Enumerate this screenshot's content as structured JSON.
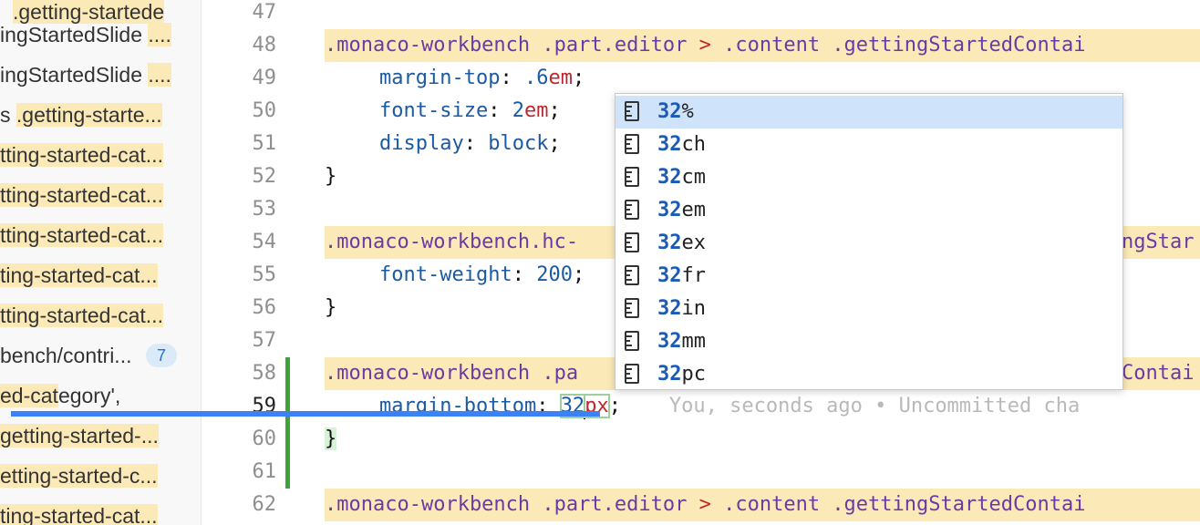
{
  "sidebar": {
    "results": [
      {
        "prefix": "",
        "match": ".getting-startede",
        "ellipsis": ""
      },
      {
        "prefix": "ingStartedSlide ",
        "match": "....",
        "ellipsis": ""
      },
      {
        "prefix": "ingStartedSlide ",
        "match": "....",
        "ellipsis": ""
      },
      {
        "prefix": "s ",
        "match": ".getting-starte...",
        "ellipsis": ""
      },
      {
        "prefix": "",
        "match": "tting-started-cat...",
        "ellipsis": ""
      },
      {
        "prefix": "",
        "match": "tting-started-cat...",
        "ellipsis": ""
      },
      {
        "prefix": "",
        "match": "tting-started-cat...",
        "ellipsis": ""
      },
      {
        "prefix": "",
        "match": "ting-started-cat...",
        "ellipsis": ""
      },
      {
        "prefix": "",
        "match": "tting-started-cat...",
        "ellipsis": ""
      }
    ],
    "file_label": "bench/contri...",
    "file_badge": "7",
    "file_results": [
      {
        "prefix": "",
        "match": "ed-cat",
        "rest": "egory',"
      },
      {
        "prefix": "",
        "match": "getting-started-...",
        "rest": ""
      },
      {
        "prefix": "",
        "match": "etting-started-c...",
        "rest": ""
      },
      {
        "prefix": "",
        "match": "ting-started-cat...",
        "rest": ""
      }
    ]
  },
  "gutter": {
    "line_numbers": [
      "47",
      "48",
      "49",
      "50",
      "51",
      "52",
      "53",
      "54",
      "55",
      "56",
      "57",
      "58",
      "59",
      "60",
      "61",
      "62"
    ],
    "active_line": "59"
  },
  "code": {
    "l48_sel1": ".monaco-workbench .part.editor",
    "l48_comb": ">",
    "l48_sel2": ".content .gettingStartedContai",
    "l49_prop": "margin-top",
    "l49_num": ".6",
    "l49_unit": "em",
    "l50_prop": "font-size",
    "l50_num": "2",
    "l50_unit": "em",
    "l51_prop": "display",
    "l51_val": "block",
    "brace_close": "}",
    "l54_sel": ".monaco-workbench.hc-",
    "l54_tail": "ngStar",
    "l55_prop": "font-weight",
    "l55_num": "200",
    "l58_sel": ".monaco-workbench .pa",
    "l58_tail": "Contai",
    "l59_prop": "margin-bottom",
    "l59_num": "32",
    "l59_unit": "px",
    "l59_blame": "You, seconds ago • Uncommitted cha",
    "l62_sel1": ".monaco-workbench .part.editor",
    "l62_comb": ">",
    "l62_sel2": ".content .gettingStartedContai"
  },
  "suggest": {
    "match": "32",
    "items": [
      "%",
      "ch",
      "cm",
      "em",
      "ex",
      "fr",
      "in",
      "mm",
      "pc"
    ],
    "selected_index": 0
  },
  "colors": {
    "selector": "#6b3aa7",
    "property": "#1b5aa5",
    "unit": "#c0272d",
    "highlight": "#fbeab7",
    "git_added": "#41a23b",
    "suggest_selected": "#cfe3fb",
    "drag_line": "#3b82f6"
  }
}
